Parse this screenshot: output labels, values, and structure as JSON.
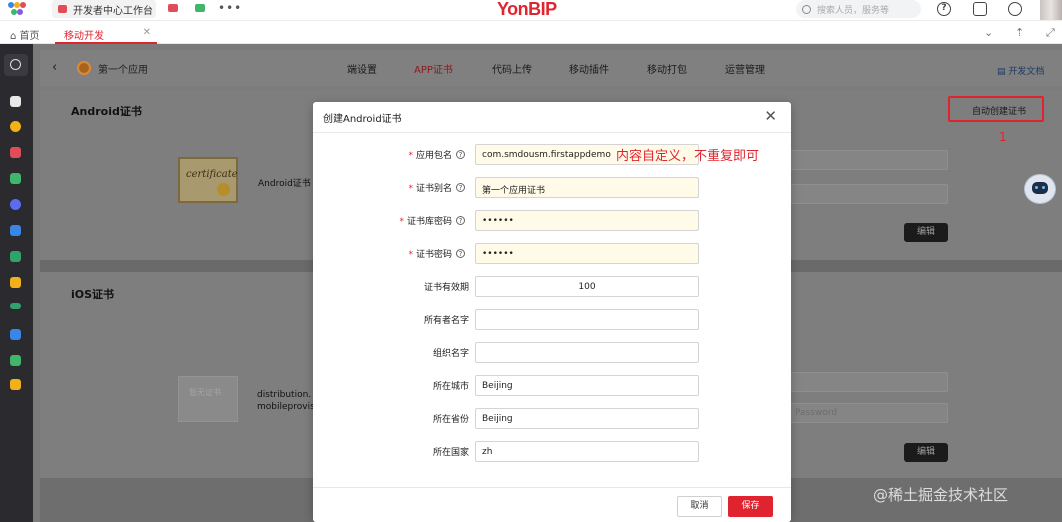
{
  "topbar": {
    "tab_label": "开发者中心工作台",
    "more": "•••",
    "brand": "YonBIP",
    "search_placeholder": "搜索人员，服务等",
    "help_glyph": "?"
  },
  "tabs": {
    "home": "首页",
    "active": "移动开发"
  },
  "app": {
    "name": "第一个应用",
    "nav": [
      "端设置",
      "APP证书",
      "代码上传",
      "移动插件",
      "移动打包",
      "运营管理"
    ],
    "active_nav": "APP证书",
    "docs": "开发文档"
  },
  "page": {
    "android_title": "Android证书",
    "android_cert_label": "Android证书",
    "certificate_img_text": "certificate",
    "ios_title": "iOS证书",
    "ios_img_text": "暂无证书",
    "ios_label_line1": "distribution.",
    "ios_label_line2": "mobileprovisi",
    "edit_label": "编辑",
    "password_placeholder": "Password",
    "auto_create": "自动创建证书",
    "step_number": "1",
    "watermark": "@稀土掘金技术社区"
  },
  "modal": {
    "title": "创建Android证书",
    "close": "✕",
    "annotation": "内容自定义，不重复即可",
    "fields": [
      {
        "label": "应用包名",
        "value": "com.smdousm.firstappdemo",
        "required": true,
        "help": true
      },
      {
        "label": "证书别名",
        "value": "第一个应用证书",
        "required": true,
        "help": true
      },
      {
        "label": "证书库密码",
        "value": "••••••",
        "required": true,
        "help": true
      },
      {
        "label": "证书密码",
        "value": "••••••",
        "required": true,
        "help": true
      },
      {
        "label": "证书有效期",
        "value": "100",
        "required": false,
        "help": false
      },
      {
        "label": "所有者名字",
        "value": "",
        "required": false,
        "help": false
      },
      {
        "label": "组织名字",
        "value": "",
        "required": false,
        "help": false
      },
      {
        "label": "所在城市",
        "value": "Beijing",
        "required": false,
        "help": false
      },
      {
        "label": "所在省份",
        "value": "Beijing",
        "required": false,
        "help": false
      },
      {
        "label": "所在国家",
        "value": "zh",
        "required": false,
        "help": false
      }
    ],
    "cancel": "取消",
    "save": "保存",
    "required_mark": "*",
    "help_glyph": "?"
  },
  "colors": {
    "brand_red": "#e0242f",
    "sidebar": "#2a2a2f",
    "modal_bg": "#ffffff"
  }
}
